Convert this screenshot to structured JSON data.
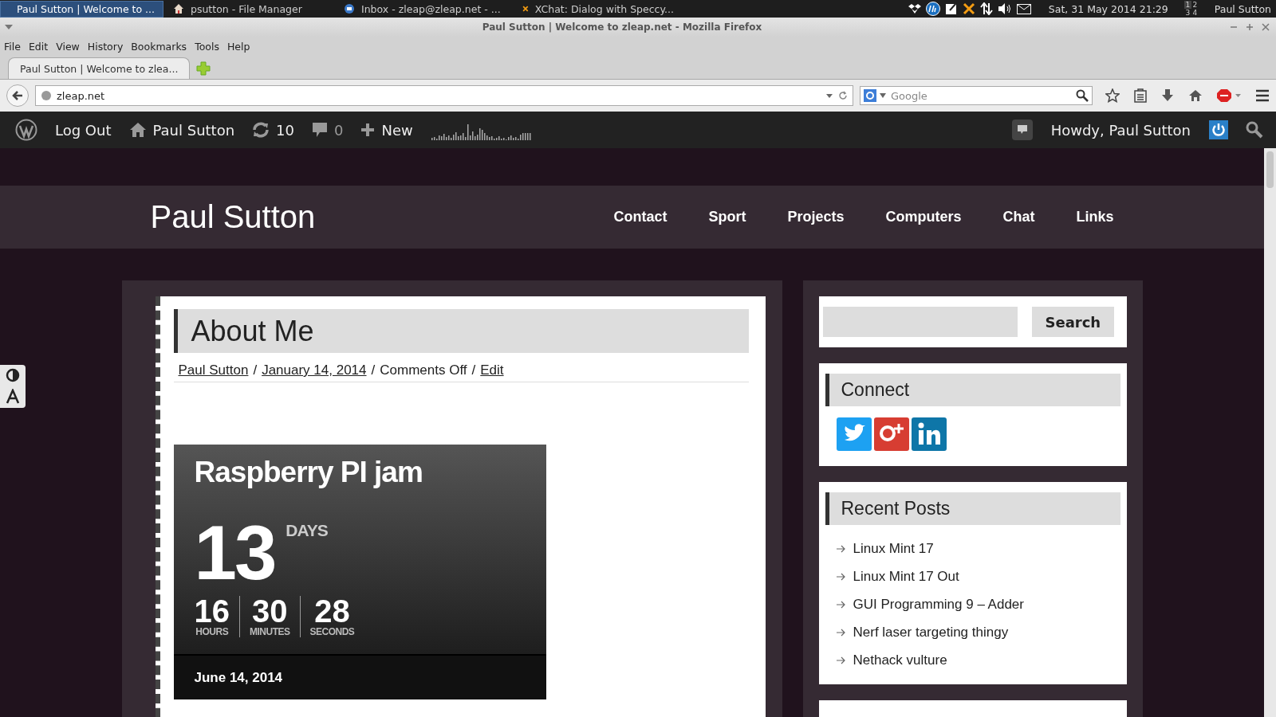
{
  "taskbar": {
    "tasks": [
      {
        "label": "Paul Sutton | Welcome to ...",
        "selected": true,
        "kind": "firefox"
      },
      {
        "label": "psutton - File Manager",
        "selected": false,
        "kind": "home"
      },
      {
        "label": "Inbox - zleap@zleap.net - ...",
        "selected": false,
        "kind": "mail"
      },
      {
        "label": "XChat: Dialog with Speccy...",
        "selected": false,
        "kind": "chat"
      }
    ],
    "clock": "Sat, 31 May 2014 21:29",
    "workspaces": [
      {
        "label": "1",
        "selected": true
      },
      {
        "label": "2",
        "selected": false
      },
      {
        "label": "3",
        "selected": false
      },
      {
        "label": "4",
        "selected": false
      }
    ],
    "user": "Paul Sutton"
  },
  "window": {
    "title": "Paul Sutton | Welcome to zleap.net - Mozilla Firefox",
    "menu": [
      "File",
      "Edit",
      "View",
      "History",
      "Bookmarks",
      "Tools",
      "Help"
    ],
    "tabs": [
      {
        "label": "Paul Sutton | Welcome to zlea...",
        "selected": true
      }
    ],
    "url": "zleap.net",
    "search": {
      "placeholder": "Google"
    }
  },
  "admin_bar": {
    "logout": "Log Out",
    "site": "Paul Sutton",
    "updates": "10",
    "comments": "0",
    "new": "New",
    "howdy": "Howdy, Paul Sutton"
  },
  "site": {
    "title": "Paul Sutton",
    "nav": [
      "Contact",
      "Sport",
      "Projects",
      "Computers",
      "Chat",
      "Links"
    ]
  },
  "post": {
    "title": "About Me",
    "byline": [
      {
        "text": "Paul Sutton",
        "kind": "link"
      },
      {
        "text": "/",
        "kind": "separator"
      },
      {
        "text": "January 14, 2014",
        "kind": "link"
      },
      {
        "text": "/",
        "kind": "separator"
      },
      {
        "text": "Comments Off",
        "kind": "text"
      },
      {
        "text": "/",
        "kind": "separator"
      },
      {
        "text": "Edit",
        "kind": "link"
      }
    ],
    "countdown": {
      "title": "Raspberry PI jam",
      "days": "13",
      "days_label": "DAYS",
      "units": [
        {
          "value": "16",
          "label": "HOURS"
        },
        {
          "value": "30",
          "label": "MINUTES"
        },
        {
          "value": "28",
          "label": "SECONDS"
        }
      ],
      "date": "June 14, 2014"
    }
  },
  "sidebar": {
    "search_button": "Search",
    "connect_title": "Connect",
    "recent_title": "Recent Posts",
    "recent_posts": [
      "Linux Mint 17",
      "Linux Mint 17 Out",
      "GUI Programming 9 – Adder",
      "Nerf laser targeting thingy",
      "Nethack vulture"
    ]
  }
}
